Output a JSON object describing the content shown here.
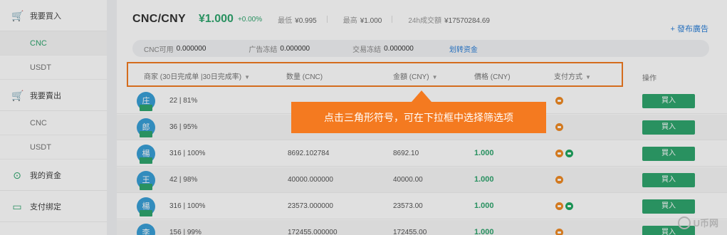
{
  "sidebar": {
    "buy_section": {
      "label": "我要買入",
      "icon": "cart-icon"
    },
    "buy_items": [
      {
        "label": "CNC",
        "active": true
      },
      {
        "label": "USDT",
        "active": false
      }
    ],
    "sell_section": {
      "label": "我要賣出",
      "icon": "cart-icon"
    },
    "sell_items": [
      {
        "label": "CNC"
      },
      {
        "label": "USDT"
      }
    ],
    "funds": {
      "label": "我的資金",
      "icon": "coin-icon"
    },
    "payment": {
      "label": "支付绑定",
      "icon": "card-icon"
    }
  },
  "header": {
    "pair": "CNC/CNY",
    "price": "¥1.000",
    "change": "+0.00%",
    "low_label": "最低",
    "low_value": "¥0.995",
    "high_label": "最高",
    "high_value": "¥1.000",
    "volume_label": "24h成交額",
    "volume_value": "¥17570284.69",
    "publish": "+ 發布廣告"
  },
  "balances": {
    "available_label": "CNC可用",
    "available_value": "0.000000",
    "ad_frozen_label": "广告冻结",
    "ad_frozen_value": "0.000000",
    "trade_frozen_label": "交易冻结",
    "trade_frozen_value": "0.000000",
    "transfer_link": "划转资金"
  },
  "table": {
    "headers": {
      "merchant": "商家 (30日完成单 |30日完成率)",
      "amount": "数量 (CNC)",
      "total": "金額 (CNY)",
      "price": "價格 (CNY)",
      "payment": "支付方式",
      "ops": "操作"
    },
    "buy_label": "買入",
    "rows": [
      {
        "avatar": "庄",
        "trades": "22 | 81%",
        "amount": "",
        "total": "",
        "price": "",
        "pay": [
          "orange"
        ]
      },
      {
        "avatar": "郎",
        "trades": "36 | 95%",
        "amount": "",
        "total": "",
        "price": "",
        "pay": [
          "orange"
        ]
      },
      {
        "avatar": "楊",
        "trades": "316 | 100%",
        "amount": "8692.102784",
        "total": "8692.10",
        "price": "1.000",
        "pay": [
          "orange",
          "green"
        ]
      },
      {
        "avatar": "王",
        "trades": "42 | 98%",
        "amount": "40000.000000",
        "total": "40000.00",
        "price": "1.000",
        "pay": [
          "orange"
        ]
      },
      {
        "avatar": "楊",
        "trades": "316 | 100%",
        "amount": "23573.000000",
        "total": "23573.00",
        "price": "1.000",
        "pay": [
          "orange",
          "green"
        ]
      },
      {
        "avatar": "李",
        "trades": "156 | 99%",
        "amount": "172455.000000",
        "total": "172455.00",
        "price": "1.000",
        "pay": [
          "orange"
        ]
      }
    ]
  },
  "tooltip": "点击三角形符号，可在下拉框中选择筛选项",
  "watermark": "U币网",
  "colors": {
    "accent_green": "#2fa56e",
    "highlight_orange": "#f27b22",
    "link_blue": "#2b7fd8"
  }
}
